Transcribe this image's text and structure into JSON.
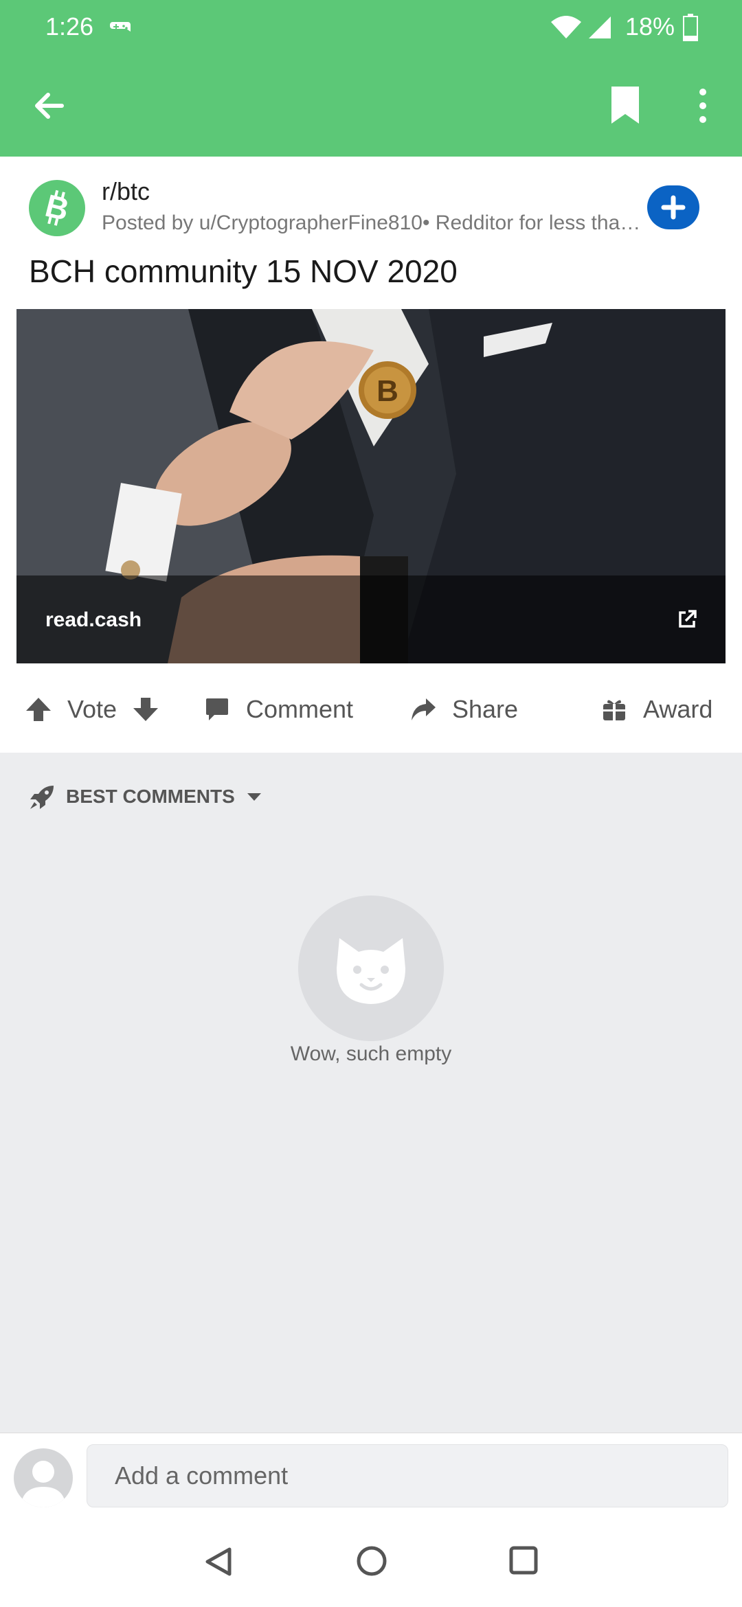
{
  "status_bar": {
    "time": "1:26",
    "battery": "18%"
  },
  "post": {
    "subreddit": "r/btc",
    "posted_by": "Posted by u/CryptographerFine810• Redditor for less than…",
    "title": "BCH community 15 NOV 2020",
    "link_domain": "read.cash"
  },
  "actions": {
    "vote_label": "Vote",
    "comment_label": "Comment",
    "share_label": "Share",
    "award_label": "Award"
  },
  "comments": {
    "sort_label": "BEST COMMENTS",
    "empty_text": "Wow, such empty"
  },
  "composer": {
    "placeholder": "Add a comment"
  },
  "colors": {
    "app_bar": "#5CC877",
    "subreddit_icon": "#5CC877",
    "join_button": "#0B63C4",
    "background": "#ECEDEF"
  },
  "icons": {
    "back": "arrow-left-icon",
    "bookmark": "bookmark-icon",
    "more": "more-vertical-icon",
    "upvote": "arrow-up-icon",
    "downvote": "arrow-down-icon",
    "comment": "speech-bubble-icon",
    "share": "share-arrow-icon",
    "award": "gift-icon",
    "sort": "rocket-icon",
    "external_link": "external-link-icon"
  }
}
